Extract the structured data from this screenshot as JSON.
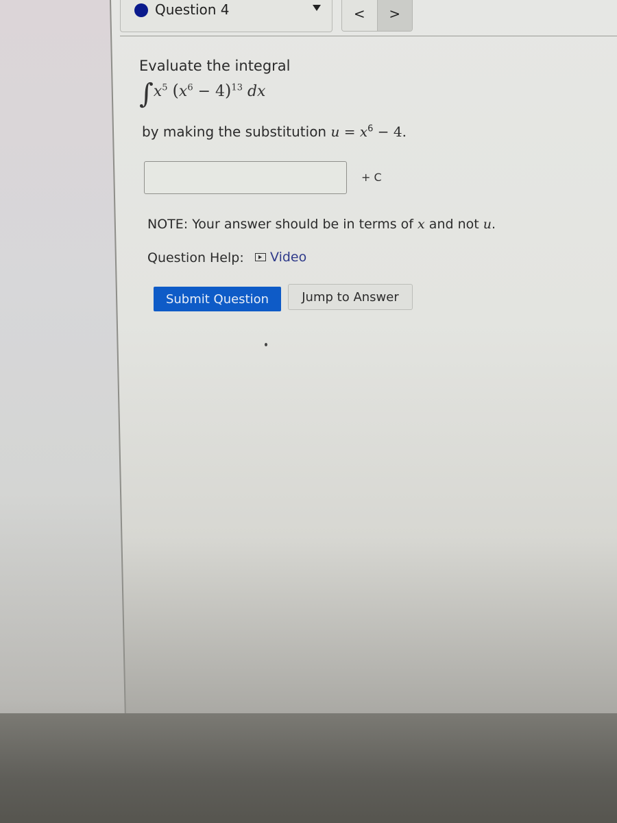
{
  "header": {
    "question_selector": {
      "label": "Question 4",
      "status_color": "#0a1a8c"
    },
    "nav": {
      "prev_label": "<",
      "next_label": ">"
    }
  },
  "question": {
    "prompt": "Evaluate the integral",
    "integral": {
      "sign": "∫",
      "term1_base": "x",
      "term1_exp": "5",
      "open_paren": "(",
      "inner_base": "x",
      "inner_exp": "6",
      "inner_rest": " − 4",
      "close_paren": ")",
      "outer_exp": "13",
      "differential": "dx"
    },
    "substitution_prefix": "by making the substitution ",
    "substitution_var": "u",
    "substitution_eq": " = ",
    "substitution_base": "x",
    "substitution_exp": "6",
    "substitution_rest": " − 4."
  },
  "answer": {
    "value": "",
    "placeholder": "",
    "suffix": "+ C"
  },
  "note": {
    "prefix": "NOTE: Your answer should be in terms of ",
    "var1": "x",
    "middle": " and not ",
    "var2": "u",
    "end": "."
  },
  "help": {
    "label": "Question Help:",
    "video_icon": "play-icon",
    "video_label": "Video"
  },
  "buttons": {
    "submit": "Submit Question",
    "jump": "Jump to Answer"
  },
  "colors": {
    "submit_bg": "#0e5bc7",
    "link": "#2f3a8a"
  }
}
